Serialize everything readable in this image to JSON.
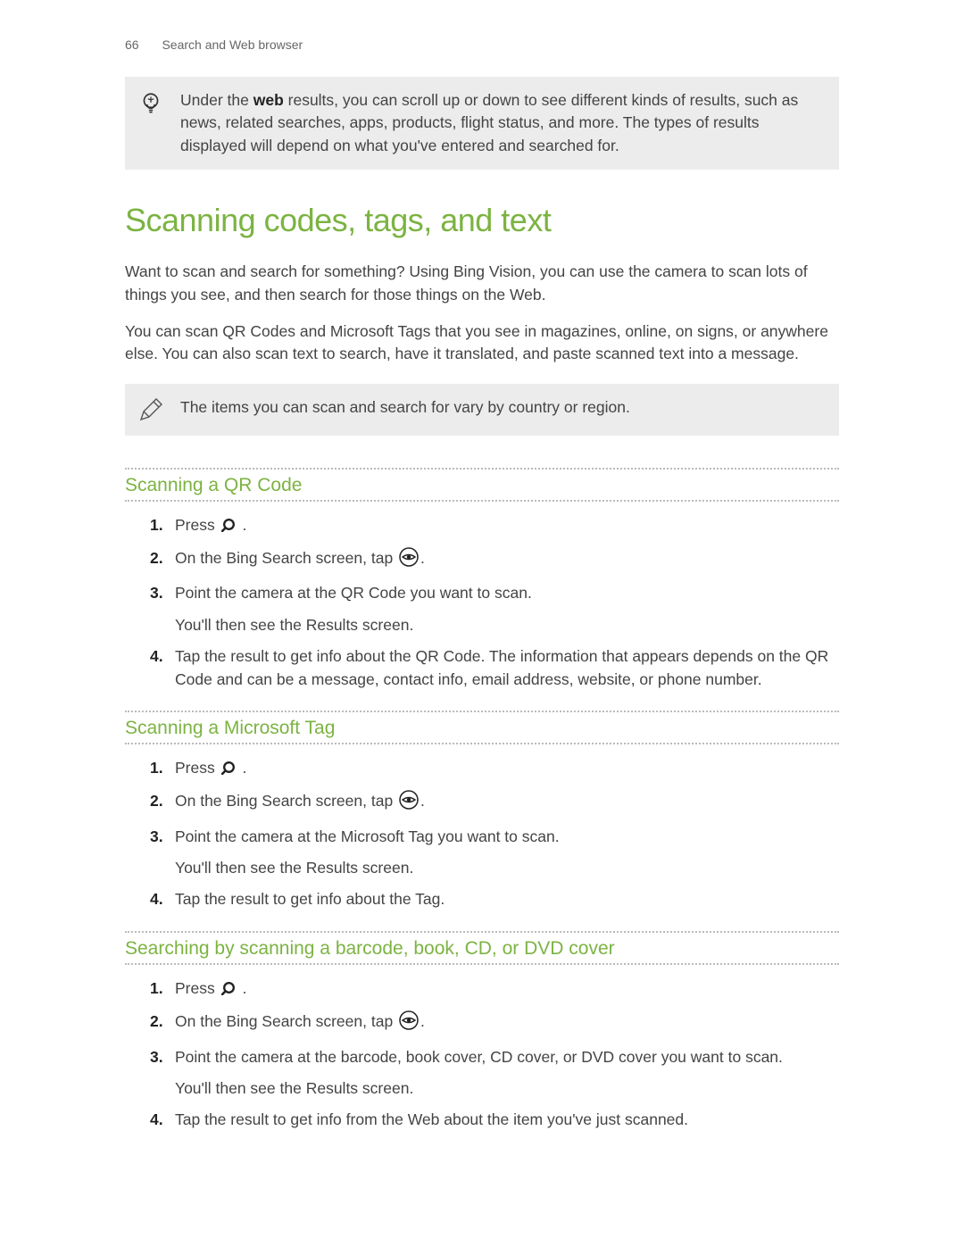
{
  "header": {
    "page": "66",
    "section": "Search and Web browser"
  },
  "tip": {
    "text_before": "Under the ",
    "text_bold": "web",
    "text_after": " results, you can scroll up or down to see different kinds of results, such as news, related searches, apps, products, flight status, and more. The types of results displayed will depend on what you've entered and searched for."
  },
  "main": {
    "heading": "Scanning codes, tags, and text",
    "p1": "Want to scan and search for something? Using Bing Vision, you can use the camera to scan lots of things you see, and then search for those things on the Web.",
    "p2": "You can scan QR Codes and Microsoft Tags that you see in magazines, online, on signs, or anywhere else. You can also scan text to search, have it translated, and paste scanned text into a message."
  },
  "note": {
    "text": "The items you can scan and search for vary by country or region."
  },
  "sections": [
    {
      "heading": "Scanning a QR Code",
      "steps": [
        {
          "pre": "Press ",
          "icon": "search",
          "post": " ."
        },
        {
          "pre": "On the Bing Search screen, tap ",
          "icon": "eye",
          "post": "."
        },
        {
          "pre": "Point the camera at the QR Code you want to scan.",
          "sub": "You'll then see the Results screen."
        },
        {
          "pre": "Tap the result to get info about the QR Code. The information that appears depends on the QR Code and can be a message, contact info, email address, website, or phone number."
        }
      ]
    },
    {
      "heading": "Scanning a Microsoft Tag",
      "steps": [
        {
          "pre": "Press ",
          "icon": "search",
          "post": " ."
        },
        {
          "pre": "On the Bing Search screen, tap ",
          "icon": "eye",
          "post": "."
        },
        {
          "pre": "Point the camera at the Microsoft Tag you want to scan.",
          "sub": "You'll then see the Results screen."
        },
        {
          "pre": "Tap the result to get info about the Tag."
        }
      ]
    },
    {
      "heading": "Searching by scanning a barcode, book, CD, or DVD cover",
      "steps": [
        {
          "pre": "Press ",
          "icon": "search",
          "post": " ."
        },
        {
          "pre": "On the Bing Search screen, tap ",
          "icon": "eye",
          "post": "."
        },
        {
          "pre": "Point the camera at the barcode, book cover, CD cover, or DVD cover you want to scan.",
          "sub": "You'll then see the Results screen."
        },
        {
          "pre": "Tap the result to get info from the Web about the item you've just scanned."
        }
      ]
    }
  ]
}
